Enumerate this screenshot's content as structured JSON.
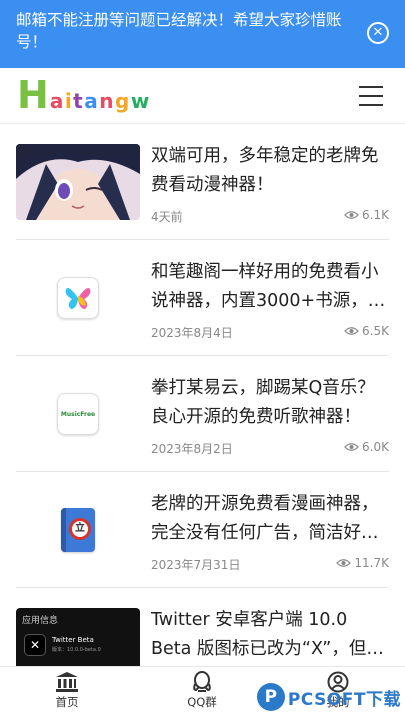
{
  "notice": {
    "text": "邮箱不能注册等问题已经解决！希望大家珍惜账号！",
    "close_icon": "close-circle-icon"
  },
  "header": {
    "logo_initial": "H",
    "logo_rest_letters": [
      "a",
      "i",
      "t",
      "a",
      "n",
      "g",
      "w"
    ],
    "logo_colors": [
      "#7ac043",
      "#e84a5f",
      "#f5a623",
      "#8e44ad",
      "#3b8ff0",
      "#e84a5f",
      "#f5a623",
      "#27ae60"
    ],
    "menu_icon": "hamburger-menu-icon"
  },
  "articles": [
    {
      "title": "双端可用，多年稳定的老牌免费看动漫神器！",
      "date": "4天前",
      "views": "6.1K",
      "thumb": "anime-girl-image"
    },
    {
      "title": "和笔趣阁一样好用的免费看小说神器，内置3000+书源，一键搜索全网！",
      "date": "2023年8月4日",
      "views": "6.5K",
      "thumb": "butterfly-app-icon"
    },
    {
      "title": "拳打某易云，脚踢某Q音乐？良心开源的免费听歌神器！",
      "date": "2023年8月2日",
      "views": "6.0K",
      "thumb": "musicfree-app-icon"
    },
    {
      "title": "老牌的开源免费看漫画神器，完全没有任何广告，简洁好用！",
      "date": "2023年7月31日",
      "views": "11.7K",
      "thumb": "book-app-icon"
    },
    {
      "title": "Twitter 安卓客户端 10.0 Beta 版图标已改为“X”，但…",
      "date": "",
      "views": "",
      "thumb": "twitter-beta-screenshot"
    }
  ],
  "thumb_texts": {
    "musicfree": "MusicFree",
    "book_badge": "立",
    "app_info": "应用信息",
    "twitter_app": "Twitter Beta",
    "twitter_version": "版本：10.0.0-beta.0"
  },
  "tabbar": {
    "home": "首页",
    "qq": "QQ群",
    "me": "我的"
  },
  "watermark": {
    "circle": "P",
    "text": "PCSOFT下载"
  }
}
